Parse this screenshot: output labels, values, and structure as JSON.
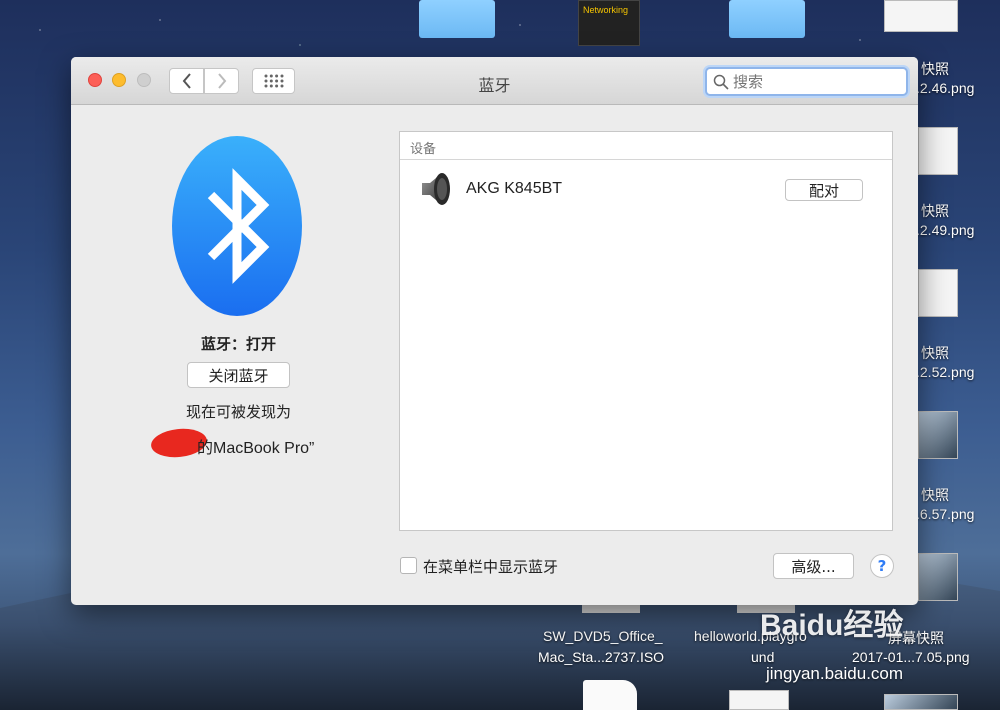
{
  "window": {
    "title": "蓝牙",
    "search_placeholder": "搜索"
  },
  "bluetooth": {
    "status": "蓝牙：打开",
    "toggle_label": "关闭蓝牙",
    "discoverable_text": "现在可被发现为",
    "device_name": "的MacBook Pro”"
  },
  "devices": {
    "header": "设备",
    "items": [
      {
        "name": "AKG K845BT",
        "action": "配对",
        "icon": "speaker-icon"
      }
    ]
  },
  "footer": {
    "show_in_menubar_label": "在菜单栏中显示蓝牙",
    "advanced_label": "高级...",
    "help_label": "?"
  },
  "desktop": {
    "files": [
      {
        "line1": "快照",
        "line2": ".2.46.png"
      },
      {
        "line1": "快照",
        "line2": ".2.49.png"
      },
      {
        "line1": "快照",
        "line2": ".2.52.png"
      },
      {
        "line1": "快照",
        "line2": ".6.57.png"
      },
      {
        "line1": "屏幕快照",
        "line2": "2017-01...7.05.png"
      }
    ],
    "iso_line1": "SW_DVD5_Office_",
    "iso_line2": "Mac_Sta...2737.ISO",
    "playground_line1": "helloworld.playgro",
    "playground_line2": "und",
    "book_title": "Networking"
  },
  "watermark": {
    "brand": "Baidu经验",
    "url": "jingyan.baidu.com"
  },
  "colors": {
    "bluetooth_blue": "#1e8cf5",
    "close": "#fc5f57",
    "minimize": "#fdbc2e",
    "accent": "#2f7cf6"
  }
}
